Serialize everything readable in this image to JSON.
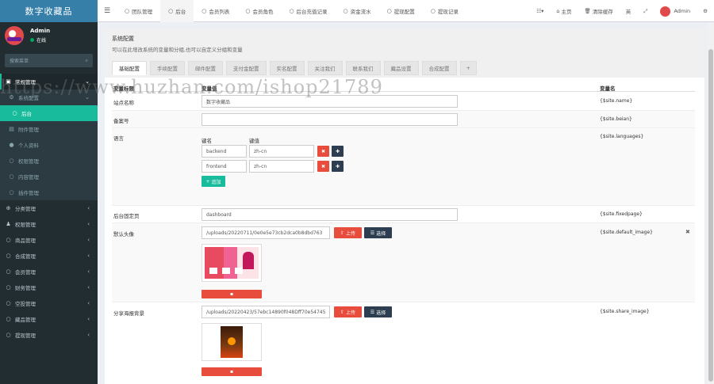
{
  "app": {
    "logo": "数字收藏品"
  },
  "user": {
    "name": "Admin",
    "status": "在线"
  },
  "sidebar": {
    "search_placeholder": "搜索菜单",
    "items": [
      {
        "icon": "dashboard-icon",
        "glyph": "▣",
        "label": "常规管理",
        "state": "open"
      },
      {
        "icon": "gear-icon",
        "glyph": "⚙",
        "label": "系统配置",
        "state": "sub"
      },
      {
        "icon": "circle-icon",
        "glyph": "○",
        "label": "后台",
        "state": "sel"
      },
      {
        "icon": "attachment-icon",
        "glyph": "▤",
        "label": "附件管理",
        "state": "child"
      },
      {
        "icon": "user-icon",
        "glyph": "●",
        "label": "个人资料",
        "state": "child"
      },
      {
        "icon": "circle-icon",
        "glyph": "○",
        "label": "权限管理",
        "state": "child"
      },
      {
        "icon": "circle-icon",
        "glyph": "○",
        "label": "内容管理",
        "state": "child"
      },
      {
        "icon": "circle-icon",
        "glyph": "○",
        "label": "插件管理",
        "state": "child"
      },
      {
        "icon": "link-icon",
        "glyph": "⊕",
        "label": "分类管理",
        "state": "normal"
      },
      {
        "icon": "users-icon",
        "glyph": "♟",
        "label": "权限管理",
        "state": "normal"
      },
      {
        "icon": "circle-icon",
        "glyph": "○",
        "label": "商品管理",
        "state": "normal"
      },
      {
        "icon": "circle-icon",
        "glyph": "○",
        "label": "合成管理",
        "state": "normal"
      },
      {
        "icon": "circle-icon",
        "glyph": "○",
        "label": "会员管理",
        "state": "normal"
      },
      {
        "icon": "circle-icon",
        "glyph": "○",
        "label": "财务管理",
        "state": "normal"
      },
      {
        "icon": "circle-icon",
        "glyph": "○",
        "label": "空投管理",
        "state": "normal"
      },
      {
        "icon": "circle-icon",
        "glyph": "○",
        "label": "藏品管理",
        "state": "normal"
      },
      {
        "icon": "circle-icon",
        "glyph": "○",
        "label": "提现管理",
        "state": "normal"
      }
    ]
  },
  "topbar": {
    "tabs": [
      {
        "label": "团队管理"
      },
      {
        "label": "后台",
        "active": true
      },
      {
        "label": "会员列表"
      },
      {
        "label": "会员角色"
      },
      {
        "label": "后台充值记录"
      },
      {
        "label": "资金流水"
      },
      {
        "label": "提现配置"
      },
      {
        "label": "提现记录"
      }
    ],
    "right": {
      "home": "主页",
      "clear_cache": "清除缓存",
      "lang": "英",
      "admin": "Admin"
    }
  },
  "panel": {
    "title": "系统配置",
    "subtitle": "可以在此增改系统的变量和分组,也可以自定义分组和变量",
    "tabs": [
      "基础配置",
      "手续配置",
      "邮件配置",
      "支付金配置",
      "实名配置",
      "关注我们",
      "联系我们",
      "藏品设置",
      "合成配置",
      "+"
    ],
    "columns": {
      "title": "变量标题",
      "value": "变量值",
      "name": "变量名"
    },
    "rows": {
      "site_name": {
        "title": "站点名称",
        "value": "数字收藏品",
        "var": "{$site.name}"
      },
      "beian": {
        "title": "备案号",
        "value": "",
        "var": "{$site.beian}"
      },
      "languages": {
        "title": "语言",
        "var": "{$site.languages}",
        "key_header": "键名",
        "val_header": "键值",
        "items": [
          {
            "key": "backend",
            "val": "zh-cn"
          },
          {
            "key": "frontend",
            "val": "zh-cn"
          }
        ],
        "add_label": "追加"
      },
      "fixedpage": {
        "title": "后台固定页",
        "value": "dashboard",
        "var": "{$site.fixedpage}"
      },
      "default_image": {
        "title": "默认头像",
        "value": "/uploads/20220711/0e0e5e73cb2dca0b8dbd763",
        "var": "{$site.default_image}",
        "upload": "上传",
        "choose": "选择"
      },
      "share_image": {
        "title": "分享海报背景",
        "value": "/uploads/20220423/57ebc14890f048Dff70e54745",
        "var": "{$site.share_image}",
        "upload": "上传",
        "choose": "选择"
      }
    }
  },
  "watermark": "https://www.huzhan.com/ishop21789"
}
